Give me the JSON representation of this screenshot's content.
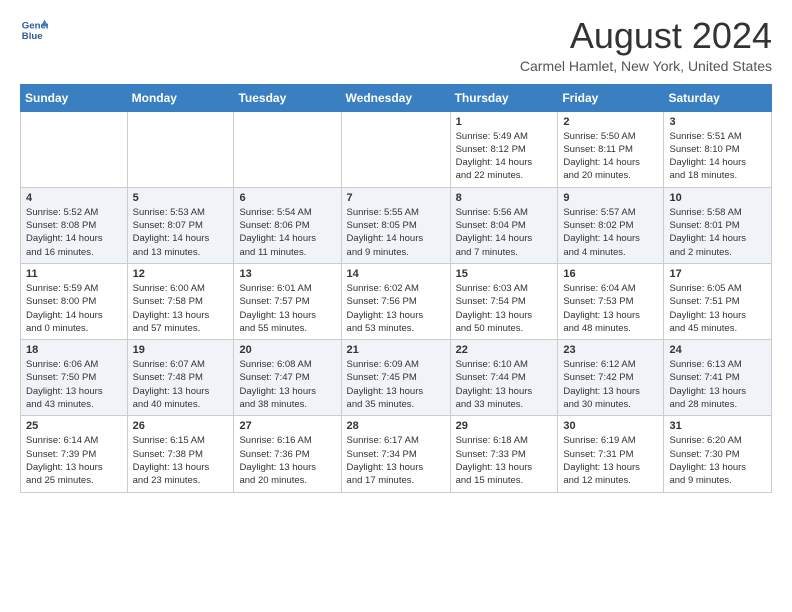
{
  "header": {
    "logo_line1": "General",
    "logo_line2": "Blue",
    "month": "August 2024",
    "location": "Carmel Hamlet, New York, United States"
  },
  "weekdays": [
    "Sunday",
    "Monday",
    "Tuesday",
    "Wednesday",
    "Thursday",
    "Friday",
    "Saturday"
  ],
  "weeks": [
    [
      {
        "day": "",
        "info": ""
      },
      {
        "day": "",
        "info": ""
      },
      {
        "day": "",
        "info": ""
      },
      {
        "day": "",
        "info": ""
      },
      {
        "day": "1",
        "info": "Sunrise: 5:49 AM\nSunset: 8:12 PM\nDaylight: 14 hours\nand 22 minutes."
      },
      {
        "day": "2",
        "info": "Sunrise: 5:50 AM\nSunset: 8:11 PM\nDaylight: 14 hours\nand 20 minutes."
      },
      {
        "day": "3",
        "info": "Sunrise: 5:51 AM\nSunset: 8:10 PM\nDaylight: 14 hours\nand 18 minutes."
      }
    ],
    [
      {
        "day": "4",
        "info": "Sunrise: 5:52 AM\nSunset: 8:08 PM\nDaylight: 14 hours\nand 16 minutes."
      },
      {
        "day": "5",
        "info": "Sunrise: 5:53 AM\nSunset: 8:07 PM\nDaylight: 14 hours\nand 13 minutes."
      },
      {
        "day": "6",
        "info": "Sunrise: 5:54 AM\nSunset: 8:06 PM\nDaylight: 14 hours\nand 11 minutes."
      },
      {
        "day": "7",
        "info": "Sunrise: 5:55 AM\nSunset: 8:05 PM\nDaylight: 14 hours\nand 9 minutes."
      },
      {
        "day": "8",
        "info": "Sunrise: 5:56 AM\nSunset: 8:04 PM\nDaylight: 14 hours\nand 7 minutes."
      },
      {
        "day": "9",
        "info": "Sunrise: 5:57 AM\nSunset: 8:02 PM\nDaylight: 14 hours\nand 4 minutes."
      },
      {
        "day": "10",
        "info": "Sunrise: 5:58 AM\nSunset: 8:01 PM\nDaylight: 14 hours\nand 2 minutes."
      }
    ],
    [
      {
        "day": "11",
        "info": "Sunrise: 5:59 AM\nSunset: 8:00 PM\nDaylight: 14 hours\nand 0 minutes."
      },
      {
        "day": "12",
        "info": "Sunrise: 6:00 AM\nSunset: 7:58 PM\nDaylight: 13 hours\nand 57 minutes."
      },
      {
        "day": "13",
        "info": "Sunrise: 6:01 AM\nSunset: 7:57 PM\nDaylight: 13 hours\nand 55 minutes."
      },
      {
        "day": "14",
        "info": "Sunrise: 6:02 AM\nSunset: 7:56 PM\nDaylight: 13 hours\nand 53 minutes."
      },
      {
        "day": "15",
        "info": "Sunrise: 6:03 AM\nSunset: 7:54 PM\nDaylight: 13 hours\nand 50 minutes."
      },
      {
        "day": "16",
        "info": "Sunrise: 6:04 AM\nSunset: 7:53 PM\nDaylight: 13 hours\nand 48 minutes."
      },
      {
        "day": "17",
        "info": "Sunrise: 6:05 AM\nSunset: 7:51 PM\nDaylight: 13 hours\nand 45 minutes."
      }
    ],
    [
      {
        "day": "18",
        "info": "Sunrise: 6:06 AM\nSunset: 7:50 PM\nDaylight: 13 hours\nand 43 minutes."
      },
      {
        "day": "19",
        "info": "Sunrise: 6:07 AM\nSunset: 7:48 PM\nDaylight: 13 hours\nand 40 minutes."
      },
      {
        "day": "20",
        "info": "Sunrise: 6:08 AM\nSunset: 7:47 PM\nDaylight: 13 hours\nand 38 minutes."
      },
      {
        "day": "21",
        "info": "Sunrise: 6:09 AM\nSunset: 7:45 PM\nDaylight: 13 hours\nand 35 minutes."
      },
      {
        "day": "22",
        "info": "Sunrise: 6:10 AM\nSunset: 7:44 PM\nDaylight: 13 hours\nand 33 minutes."
      },
      {
        "day": "23",
        "info": "Sunrise: 6:12 AM\nSunset: 7:42 PM\nDaylight: 13 hours\nand 30 minutes."
      },
      {
        "day": "24",
        "info": "Sunrise: 6:13 AM\nSunset: 7:41 PM\nDaylight: 13 hours\nand 28 minutes."
      }
    ],
    [
      {
        "day": "25",
        "info": "Sunrise: 6:14 AM\nSunset: 7:39 PM\nDaylight: 13 hours\nand 25 minutes."
      },
      {
        "day": "26",
        "info": "Sunrise: 6:15 AM\nSunset: 7:38 PM\nDaylight: 13 hours\nand 23 minutes."
      },
      {
        "day": "27",
        "info": "Sunrise: 6:16 AM\nSunset: 7:36 PM\nDaylight: 13 hours\nand 20 minutes."
      },
      {
        "day": "28",
        "info": "Sunrise: 6:17 AM\nSunset: 7:34 PM\nDaylight: 13 hours\nand 17 minutes."
      },
      {
        "day": "29",
        "info": "Sunrise: 6:18 AM\nSunset: 7:33 PM\nDaylight: 13 hours\nand 15 minutes."
      },
      {
        "day": "30",
        "info": "Sunrise: 6:19 AM\nSunset: 7:31 PM\nDaylight: 13 hours\nand 12 minutes."
      },
      {
        "day": "31",
        "info": "Sunrise: 6:20 AM\nSunset: 7:30 PM\nDaylight: 13 hours\nand 9 minutes."
      }
    ]
  ]
}
